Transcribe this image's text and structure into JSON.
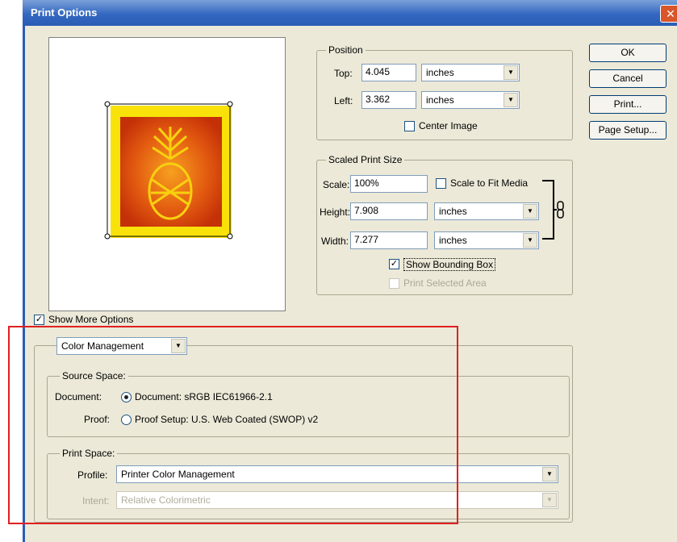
{
  "window": {
    "title": "Print Options",
    "close_glyph": "✕"
  },
  "buttons": {
    "ok": "OK",
    "cancel": "Cancel",
    "print": "Print...",
    "page_setup": "Page Setup..."
  },
  "position": {
    "label": "Position",
    "top_label": "Top:",
    "top_value": "4.045",
    "top_unit": "inches",
    "left_label": "Left:",
    "left_value": "3.362",
    "left_unit": "inches",
    "center_image": "Center Image"
  },
  "scaled": {
    "label": "Scaled Print Size",
    "scale_label": "Scale:",
    "scale_value": "100%",
    "scale_to_fit": "Scale to Fit Media",
    "height_label": "Height:",
    "height_value": "7.908",
    "height_unit": "inches",
    "width_label": "Width:",
    "width_value": "7.277",
    "width_unit": "inches",
    "show_bounding_box": "Show Bounding Box",
    "print_selected_area": "Print Selected Area"
  },
  "show_more_options": "Show More Options",
  "color": {
    "dropdown_value": "Color Management",
    "source_space_label": "Source Space:",
    "document_label": "Document:",
    "document_option": "Document:  sRGB IEC61966-2.1",
    "proof_label": "Proof:",
    "proof_option": "Proof Setup:  U.S. Web Coated (SWOP) v2",
    "print_space_label": "Print Space:",
    "profile_label": "Profile:",
    "profile_value": "Printer Color Management",
    "intent_label": "Intent:",
    "intent_value": "Relative Colorimetric"
  },
  "colors": {
    "title_bar": "#3468c0",
    "dialog_bg": "#ece9d8",
    "highlight_box": "#e02020"
  },
  "icons": {
    "chain": "link-icon",
    "dropdown": "chevron-down-icon"
  }
}
